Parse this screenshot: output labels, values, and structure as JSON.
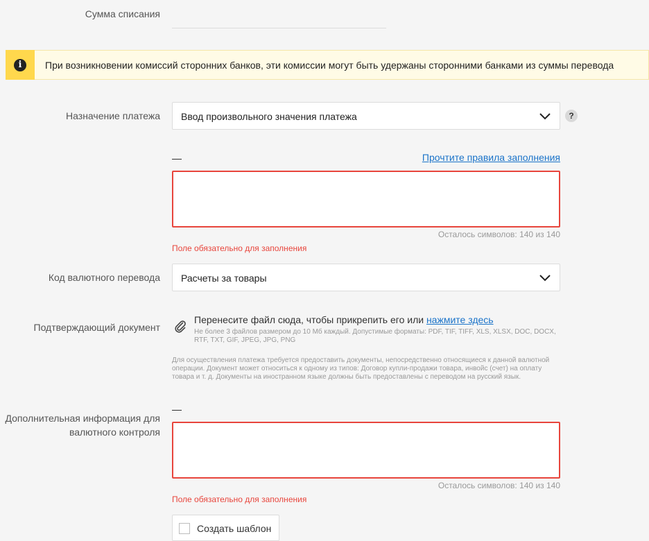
{
  "amount": {
    "label": "Сумма списания"
  },
  "banner": {
    "icon": "info-icon",
    "icon_glyph": "i",
    "text": "При возникновении комиссий сторонних банков, эти комиссии могут быть удержаны сторонними банками из суммы перевода",
    "accent_color": "#ffd84d"
  },
  "purpose": {
    "label": "Назначение платежа",
    "selected": "Ввод произвольного значения платежа",
    "help_glyph": "?",
    "dash": "—",
    "rules_link": "Прочтите правила заполнения",
    "counter": "Осталось символов: 140 из 140",
    "error": "Поле обязательно для заполнения"
  },
  "currency_code": {
    "label": "Код валютного перевода",
    "selected": "Расчеты за товары"
  },
  "document": {
    "label": "Подтверждающий документ",
    "upload_text": "Перенесите файл сюда, чтобы прикрепить его или",
    "upload_link": "нажмите здесь",
    "upload_hint": "Не более 3 файлов размером до 10 Мб каждый. Допустимые форматы: PDF, TIF, TIFF, XLS, XLSX, DOC, DOCX, RTF, TXT, GIF, JPEG, JPG, PNG",
    "notice": "Для осуществления платежа требуется предоставить документы, непосредственно относящиеся к данной валютной операции. Документ может относиться к одному из типов: Договор купли-продажи товара, инвойс (счет) на оплату товара и т. д. Документы на иностранном языке должны быть предоставлены с переводом на русский язык."
  },
  "additional": {
    "label_line1": "Дополнительная информация для",
    "label_line2": "валютного контроля",
    "dash": "—",
    "counter": "Осталось символов: 140 из 140",
    "error": "Поле обязательно для заполнения"
  },
  "template": {
    "checkbox_label": "Создать шаблон"
  },
  "colors": {
    "error": "#e8453c",
    "link": "#1a73c9",
    "background": "#f5f5f5"
  }
}
